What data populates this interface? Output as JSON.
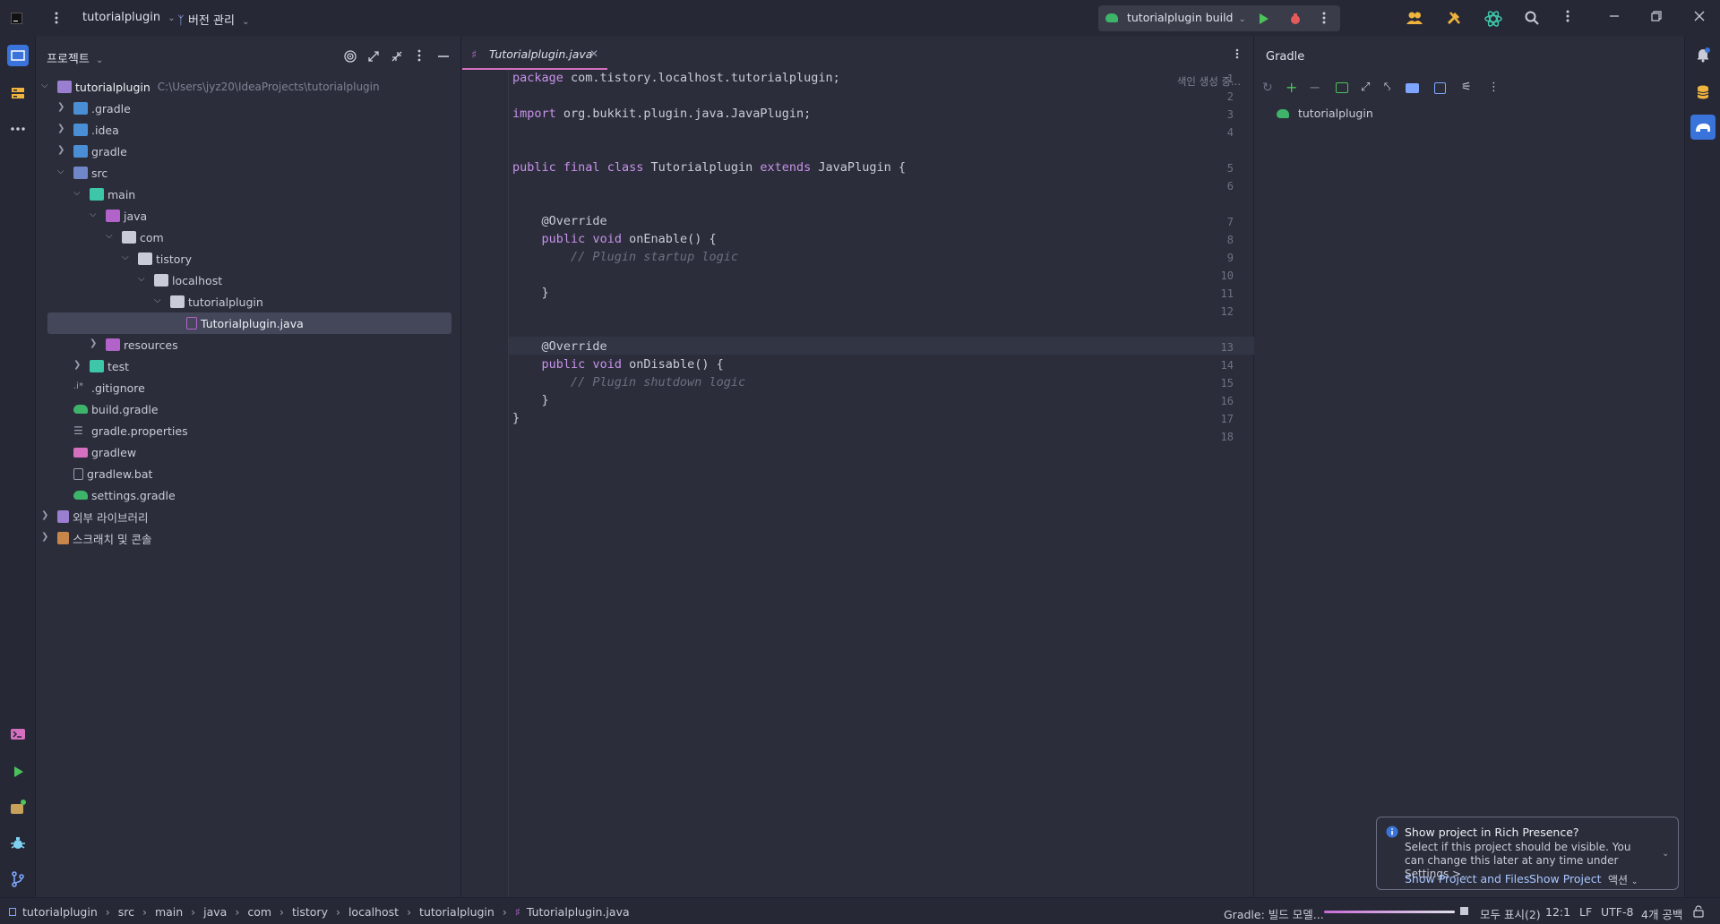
{
  "titlebar": {
    "project_name": "tutorialplugin",
    "vcs_label": "버전 관리",
    "run_config": "tutorialplugin build"
  },
  "project_panel": {
    "header": "프로젝트",
    "root_name": "tutorialplugin",
    "root_path": "C:\\Users\\jyz20\\IdeaProjects\\tutorialplugin",
    "tree": [
      {
        "label": ".gradle"
      },
      {
        "label": ".idea"
      },
      {
        "label": "gradle"
      },
      {
        "label": "src"
      },
      {
        "label": "main"
      },
      {
        "label": "java"
      },
      {
        "label": "com"
      },
      {
        "label": "tistory"
      },
      {
        "label": "localhost"
      },
      {
        "label": "tutorialplugin"
      },
      {
        "label": "Tutorialplugin.java"
      },
      {
        "label": "resources"
      },
      {
        "label": "test"
      },
      {
        "label": ".gitignore"
      },
      {
        "label": "build.gradle"
      },
      {
        "label": "gradle.properties"
      },
      {
        "label": "gradlew"
      },
      {
        "label": "gradlew.bat"
      },
      {
        "label": "settings.gradle"
      },
      {
        "label": "외부 라이브러리"
      },
      {
        "label": "스크래치 및 콘솔"
      }
    ]
  },
  "editor": {
    "tab_label": "Tutorialplugin.java",
    "indexing_label": "색인 생성 중...",
    "line_numbers": [
      "1",
      "2",
      "3",
      "4",
      "5",
      "6",
      "7",
      "8",
      "9",
      "10",
      "11",
      "12",
      "13",
      "14",
      "15",
      "16",
      "17",
      "18"
    ],
    "lines": [
      "package com.tistory.localhost.tutorialplugin;",
      "",
      "import org.bukkit.plugin.java.JavaPlugin;",
      "",
      "public final class Tutorialplugin extends JavaPlugin {",
      "",
      "    @Override",
      "    public void onEnable() {",
      "        // Plugin startup logic",
      "",
      "    }",
      "",
      "    @Override",
      "    public void onDisable() {",
      "        // Plugin shutdown logic",
      "    }",
      "}",
      ""
    ]
  },
  "gradle_panel": {
    "title": "Gradle",
    "project_item": "tutorialplugin"
  },
  "notification": {
    "title": "Show project in Rich Presence?",
    "body": "Select if this project should be visible. You can change this later at any time under Settings >...",
    "action_1": "Show Project and Files",
    "action_2": "Show Project",
    "action_3": "액션"
  },
  "statusbar": {
    "breadcrumb": [
      "tutorialplugin",
      "src",
      "main",
      "java",
      "com",
      "tistory",
      "localhost",
      "tutorialplugin",
      "Tutorialplugin.java"
    ],
    "gradle_status": "Gradle: 빌드 모델...",
    "show_all": "모두 표시(2)",
    "cursor_pos": "12:1",
    "line_sep": "LF",
    "encoding": "UTF-8",
    "indent": "4개 공백"
  },
  "colors": {
    "accent": "#d56fbf",
    "background": "#2b2d3a",
    "keyword": "#c792ea",
    "comment": "#6d6f80",
    "selection": "#434759",
    "gradle_green": "#3db46a",
    "run_green": "#4cc25b",
    "debug_red": "#e55a5a"
  }
}
